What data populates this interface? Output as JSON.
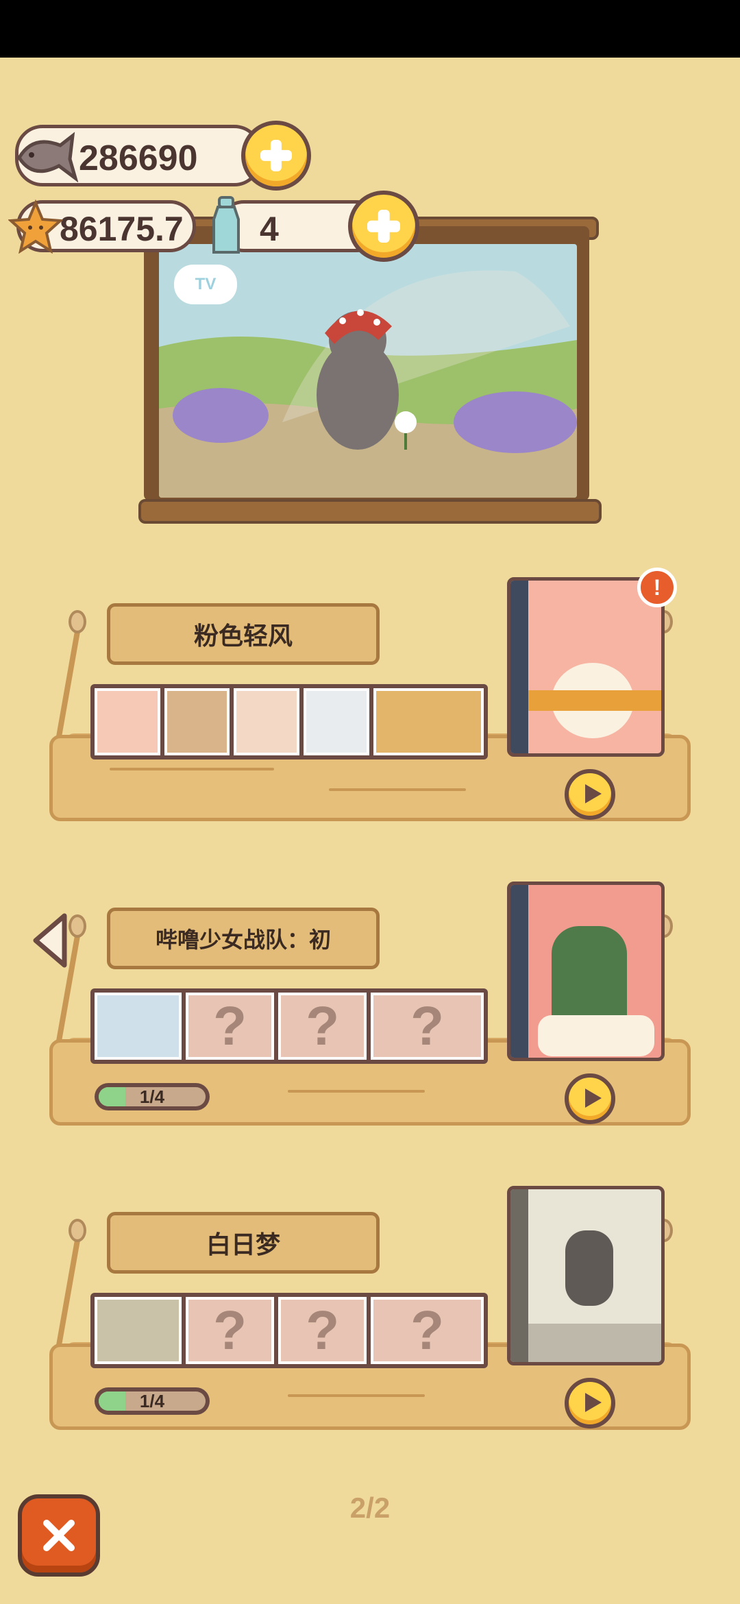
{
  "currencies": {
    "fish": {
      "icon": "fish-icon",
      "value": "286690"
    },
    "star": {
      "icon": "star-icon",
      "value": "86175.7"
    },
    "bottle": {
      "icon": "bottle-icon",
      "value": "4"
    }
  },
  "tv": {
    "logo": "TV"
  },
  "albums": [
    {
      "title": "粉色轻风",
      "thumbs": 5,
      "locked": 0,
      "has_alert": true,
      "alert_symbol": "!"
    },
    {
      "title": "哔噜少女战队：初",
      "thumbs": 1,
      "locked": 3,
      "progress_label": "1/4",
      "progress": 0.25
    },
    {
      "title": "白日梦",
      "thumbs": 1,
      "locked": 3,
      "progress_label": "1/4",
      "progress": 0.25
    }
  ],
  "locked_symbol": "?",
  "pagination": {
    "label": "2/2"
  },
  "colors": {
    "background": "#efd99b",
    "accent": "#ffd44a",
    "close": "#e05b22"
  }
}
